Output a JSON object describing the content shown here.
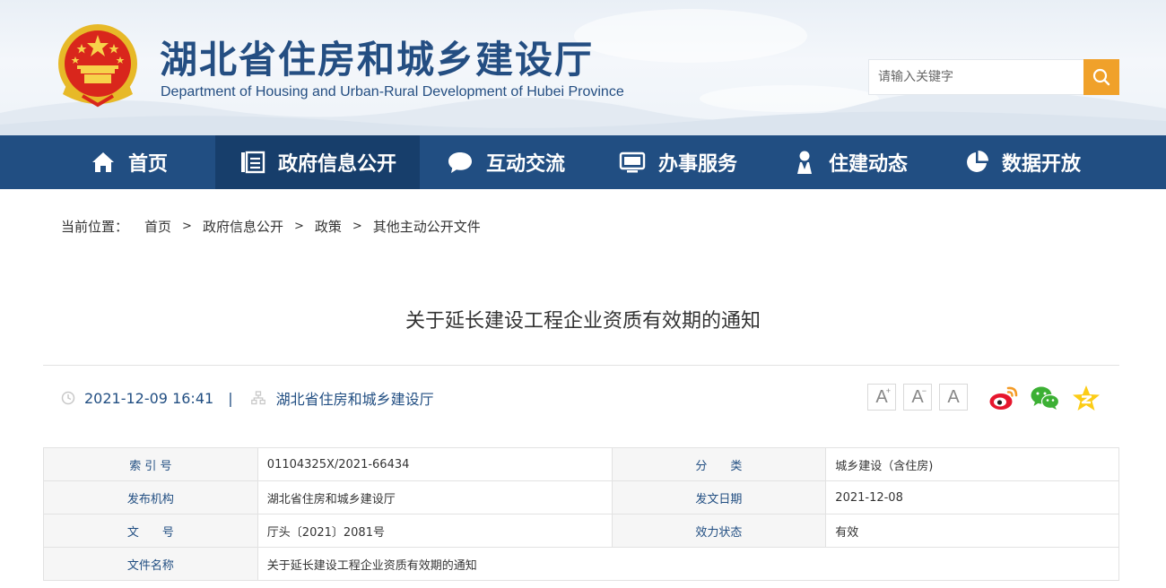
{
  "header": {
    "title": "湖北省住房和城乡建设厅",
    "subtitle": "Department of Housing and Urban-Rural Development of Hubei Province",
    "emblem_icon": "national-emblem-icon"
  },
  "search": {
    "placeholder": "请输入关键字",
    "button_icon": "search-icon",
    "button_color": "#f0a12a"
  },
  "nav": {
    "items": [
      {
        "label": "首页",
        "icon": "home-icon"
      },
      {
        "label": "政府信息公开",
        "icon": "document-list-icon",
        "active": true
      },
      {
        "label": "互动交流",
        "icon": "chat-bubble-icon"
      },
      {
        "label": "办事服务",
        "icon": "monitor-icon"
      },
      {
        "label": "住建动态",
        "icon": "person-badge-icon"
      },
      {
        "label": "数据开放",
        "icon": "pie-chart-icon"
      }
    ],
    "color": "#214e82",
    "active_color": "#173e6b"
  },
  "breadcrumb": {
    "label": "当前位置：",
    "items": [
      "首页",
      "政府信息公开",
      "政策",
      "其他主动公开文件"
    ],
    "separator": ">"
  },
  "article": {
    "title": "关于延长建设工程企业资质有效期的通知",
    "datetime": "2021-12-09 16:41",
    "divider": "|",
    "source": "湖北省住房和城乡建设厅"
  },
  "font_size_buttons": [
    "A",
    "A",
    "A"
  ],
  "share_icons": [
    "weibo-icon",
    "wechat-icon",
    "qzone-icon"
  ],
  "info_table": {
    "rows": [
      {
        "k1": "索 引 号",
        "v1": "01104325X/2021-66434",
        "k2": "分　　类",
        "v2": "城乡建设（含住房)"
      },
      {
        "k1": "发布机构",
        "v1": "湖北省住房和城乡建设厅",
        "k2": "发文日期",
        "v2": "2021-12-08"
      },
      {
        "k1": "文　　号",
        "v1": "厅头〔2021〕2081号",
        "k2": "效力状态",
        "v2": "有效"
      },
      {
        "k1": "文件名称",
        "v1": "关于延长建设工程企业资质有效期的通知"
      }
    ]
  }
}
